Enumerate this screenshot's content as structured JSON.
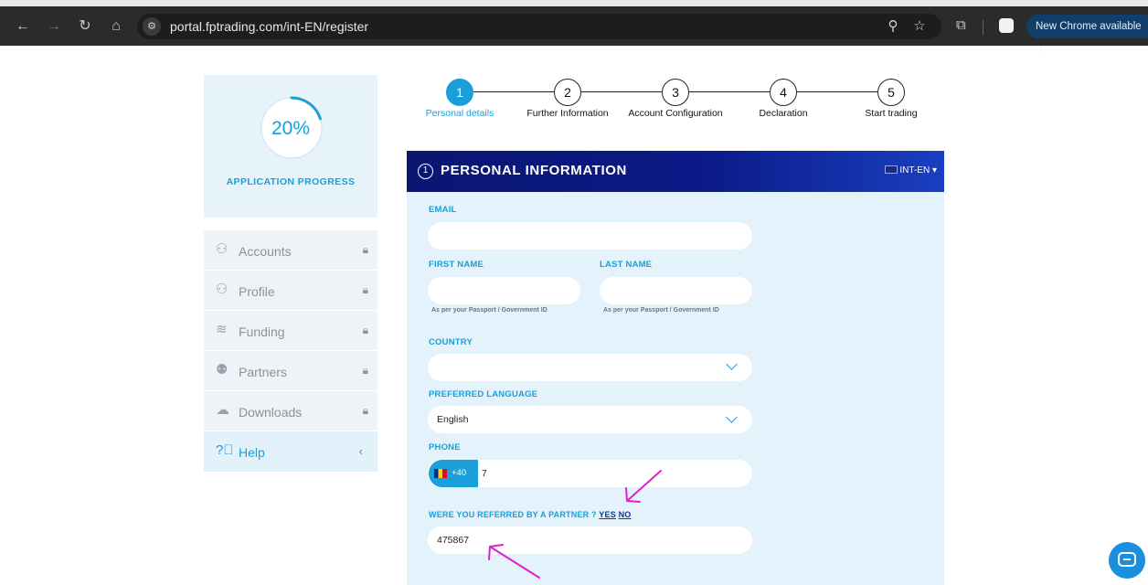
{
  "browser": {
    "url": "portal.fptrading.com/int-EN/register",
    "update_label": "New Chrome available"
  },
  "progress": {
    "percent_label": "20%",
    "percent_value": 0.2,
    "title": "APPLICATION PROGRESS"
  },
  "menu": {
    "items": [
      {
        "label": "Accounts",
        "icon": "user-icon",
        "locked": true
      },
      {
        "label": "Profile",
        "icon": "user-plus-icon",
        "locked": true
      },
      {
        "label": "Funding",
        "icon": "coins-icon",
        "locked": true
      },
      {
        "label": "Partners",
        "icon": "partners-icon",
        "locked": true
      },
      {
        "label": "Downloads",
        "icon": "cloud-download-icon",
        "locked": true
      }
    ],
    "help": {
      "label": "Help",
      "icon": "question-icon"
    }
  },
  "stepper": {
    "steps": [
      {
        "number": "1",
        "label": "Personal details",
        "active": true
      },
      {
        "number": "2",
        "label": "Further Information",
        "active": false
      },
      {
        "number": "3",
        "label": "Account Configuration",
        "active": false
      },
      {
        "number": "4",
        "label": "Declaration",
        "active": false
      },
      {
        "number": "5",
        "label": "Start trading",
        "active": false
      }
    ]
  },
  "form": {
    "section_number": "1",
    "section_title": "PERSONAL INFORMATION",
    "language_selector": "INT-EN",
    "email": {
      "label": "EMAIL",
      "value": ""
    },
    "first_name": {
      "label": "FIRST NAME",
      "value": "",
      "hint": "As per your Passport / Government ID"
    },
    "last_name": {
      "label": "LAST NAME",
      "value": "",
      "hint": "As per your Passport / Government ID"
    },
    "country": {
      "label": "COUNTRY",
      "value": ""
    },
    "preferred_language": {
      "label": "PREFERRED LANGUAGE",
      "value": "English"
    },
    "phone": {
      "label": "PHONE",
      "code": "+40",
      "value": "7"
    },
    "referral": {
      "question": "WERE YOU REFERRED BY A PARTNER ?",
      "yes": "YES",
      "no": "NO",
      "value": "475867"
    }
  },
  "colors": {
    "accent": "#1a9fd8",
    "header_dark": "#0a1670",
    "panel_bg": "#e3f2fb",
    "annotation_arrow": "#e020d0"
  }
}
